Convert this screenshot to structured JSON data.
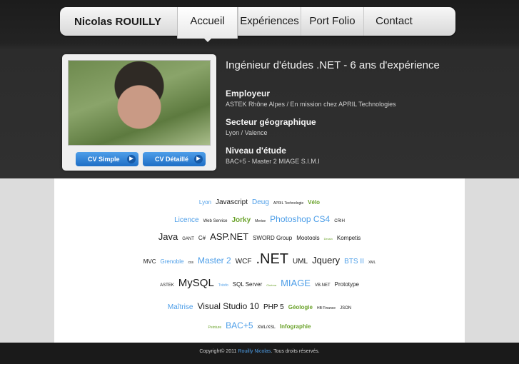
{
  "nav": {
    "brand": "Nicolas ROUILLY",
    "items": [
      {
        "label": "Accueil",
        "active": true
      },
      {
        "label": "Expériences",
        "active": false
      },
      {
        "label": "Port Folio",
        "active": false
      },
      {
        "label": "Contact",
        "active": false
      }
    ]
  },
  "profile": {
    "buttons": [
      {
        "label": "CV Simple",
        "icon": "arrow-right-icon"
      },
      {
        "label": "CV Détaillé",
        "icon": "arrow-right-icon"
      }
    ],
    "headline": "Ingénieur d'études .NET - 6 ans d'expérience",
    "sections": [
      {
        "label": "Employeur",
        "value": "ASTEK Rhône Alpes / En mission chez APRIL Technologies"
      },
      {
        "label": "Secteur géographique",
        "value": "Lyon / Valence"
      },
      {
        "label": "Niveau d'étude",
        "value": "BAC+5 - Master 2 MIAGE S.I.M.I"
      }
    ]
  },
  "tagcloud": {
    "rows": [
      [
        {
          "text": "Lyon",
          "size": 8,
          "color": "#4d9ee8"
        },
        {
          "text": "Javascript",
          "size": 10,
          "color": "#1a1a1a"
        },
        {
          "text": "Deug",
          "size": 10,
          "color": "#4d9ee8"
        },
        {
          "text": "APRIL Technologie",
          "size": 5,
          "color": "#1a1a1a"
        },
        {
          "text": "Vélo",
          "size": 8,
          "color": "#6aa22a",
          "bold": true
        }
      ],
      [
        {
          "text": "Licence",
          "size": 10,
          "color": "#4d9ee8"
        },
        {
          "text": "Web Service",
          "size": 6,
          "color": "#1a1a1a"
        },
        {
          "text": "Jorky",
          "size": 10,
          "color": "#6aa22a",
          "bold": true
        },
        {
          "text": "Merise",
          "size": 5,
          "color": "#1a1a1a"
        },
        {
          "text": "Photoshop CS4",
          "size": 12,
          "color": "#4d9ee8"
        },
        {
          "text": "CRIH",
          "size": 6,
          "color": "#1a1a1a"
        }
      ],
      [
        {
          "text": "Java",
          "size": 13,
          "color": "#1a1a1a"
        },
        {
          "text": "GANT",
          "size": 6,
          "color": "#1a1a1a"
        },
        {
          "text": "C#",
          "size": 8,
          "color": "#1a1a1a"
        },
        {
          "text": "ASP.NET",
          "size": 13,
          "color": "#1a1a1a"
        },
        {
          "text": "SWORD Group",
          "size": 8,
          "color": "#1a1a1a"
        },
        {
          "text": "Mootools",
          "size": 8,
          "color": "#1a1a1a"
        },
        {
          "text": "Dessin",
          "size": 4,
          "color": "#6aa22a"
        },
        {
          "text": "Kompetis",
          "size": 8,
          "color": "#1a1a1a"
        }
      ],
      [
        {
          "text": "MVC",
          "size": 8,
          "color": "#1a1a1a"
        },
        {
          "text": "Grenoble",
          "size": 8,
          "color": "#4d9ee8"
        },
        {
          "text": "css",
          "size": 5,
          "color": "#1a1a1a"
        },
        {
          "text": "Master 2",
          "size": 12,
          "color": "#4d9ee8"
        },
        {
          "text": "WCF",
          "size": 10,
          "color": "#1a1a1a"
        },
        {
          "text": ".NET",
          "size": 20,
          "color": "#1a1a1a"
        },
        {
          "text": "UML",
          "size": 10,
          "color": "#1a1a1a"
        },
        {
          "text": "Jquery",
          "size": 13,
          "color": "#1a1a1a"
        },
        {
          "text": "BTS II",
          "size": 10,
          "color": "#4d9ee8"
        },
        {
          "text": "XML",
          "size": 5,
          "color": "#1a1a1a"
        }
      ],
      [
        {
          "text": "ASTEK",
          "size": 6,
          "color": "#1a1a1a"
        },
        {
          "text": "MySQL",
          "size": 15,
          "color": "#1a1a1a"
        },
        {
          "text": "Trésfo",
          "size": 5,
          "color": "#4d9ee8"
        },
        {
          "text": "SQL Server",
          "size": 8,
          "color": "#1a1a1a"
        },
        {
          "text": "Cinéma",
          "size": 4,
          "color": "#6aa22a"
        },
        {
          "text": "MIAGE",
          "size": 13,
          "color": "#4d9ee8"
        },
        {
          "text": "VB.NET",
          "size": 6,
          "color": "#1a1a1a"
        },
        {
          "text": "Prototype",
          "size": 8,
          "color": "#1a1a1a"
        }
      ],
      [
        {
          "text": "Maîtrise",
          "size": 10,
          "color": "#4d9ee8"
        },
        {
          "text": "Visual Studio 10",
          "size": 12,
          "color": "#1a1a1a"
        },
        {
          "text": "PHP 5",
          "size": 10,
          "color": "#1a1a1a"
        },
        {
          "text": "Géologie",
          "size": 8,
          "color": "#6aa22a",
          "bold": true
        },
        {
          "text": "HB Finance",
          "size": 5,
          "color": "#1a1a1a"
        },
        {
          "text": "JSON",
          "size": 6,
          "color": "#1a1a1a"
        }
      ],
      [
        {
          "text": "Peinture",
          "size": 5,
          "color": "#6aa22a"
        },
        {
          "text": "BAC+5",
          "size": 12,
          "color": "#4d9ee8"
        },
        {
          "text": "XML/XSL",
          "size": 6,
          "color": "#1a1a1a"
        },
        {
          "text": "Infographie",
          "size": 8,
          "color": "#6aa22a",
          "bold": true
        }
      ]
    ]
  },
  "footer": {
    "prefix": "Copyright© 2011",
    "link": "Rouilly Nicolas",
    "suffix": ". Tous droits réservés."
  }
}
